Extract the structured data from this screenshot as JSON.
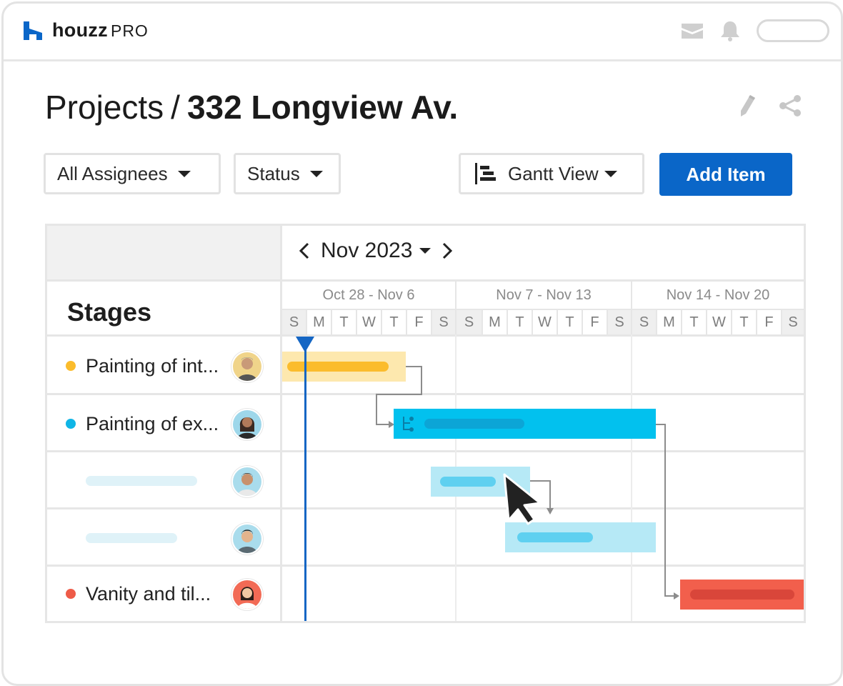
{
  "brand": {
    "name": "houzz",
    "suffix": "PRO",
    "color": "#0a66c8"
  },
  "header": {
    "icons": [
      "mail-icon",
      "bell-icon"
    ]
  },
  "page": {
    "breadcrumb_root": "Projects",
    "separator": "/",
    "project_name": "332 Longview Av."
  },
  "toolbar": {
    "assignees_label": "All Assignees",
    "status_label": "Status",
    "view_label": "Gantt View",
    "add_label": "Add Item"
  },
  "timeline": {
    "month_label": "Nov 2023",
    "weeks": [
      "Oct 28 - Nov 6",
      "Nov 7 - Nov 13",
      "Nov 14 - Nov 20"
    ],
    "days": [
      "S",
      "M",
      "T",
      "W",
      "T",
      "F",
      "S",
      "S",
      "M",
      "T",
      "W",
      "T",
      "F",
      "S",
      "S",
      "M",
      "T",
      "W",
      "T",
      "F",
      "S"
    ]
  },
  "stages_title": "Stages",
  "rows": [
    {
      "name": "Painting of int...",
      "dot_color": "#fbbc2c",
      "placeholder": false
    },
    {
      "name": "Painting of ex...",
      "dot_color": "#10b5e6",
      "placeholder": false
    },
    {
      "name": "",
      "dot_color": "",
      "placeholder": true
    },
    {
      "name": "",
      "dot_color": "",
      "placeholder": true
    },
    {
      "name": "Vanity and til...",
      "dot_color": "#ee5b48",
      "placeholder": false
    }
  ],
  "colors": {
    "yellow_light": "#fde8ae",
    "yellow": "#fbbc2c",
    "cyan": "#02c1ee",
    "cyan_dark": "#0ca5d6",
    "cyan_light": "#b6e9f6",
    "cyan_mid": "#5fd0f0",
    "red": "#f25f4c",
    "red_dark": "#d9463a",
    "today": "#1566c4"
  }
}
